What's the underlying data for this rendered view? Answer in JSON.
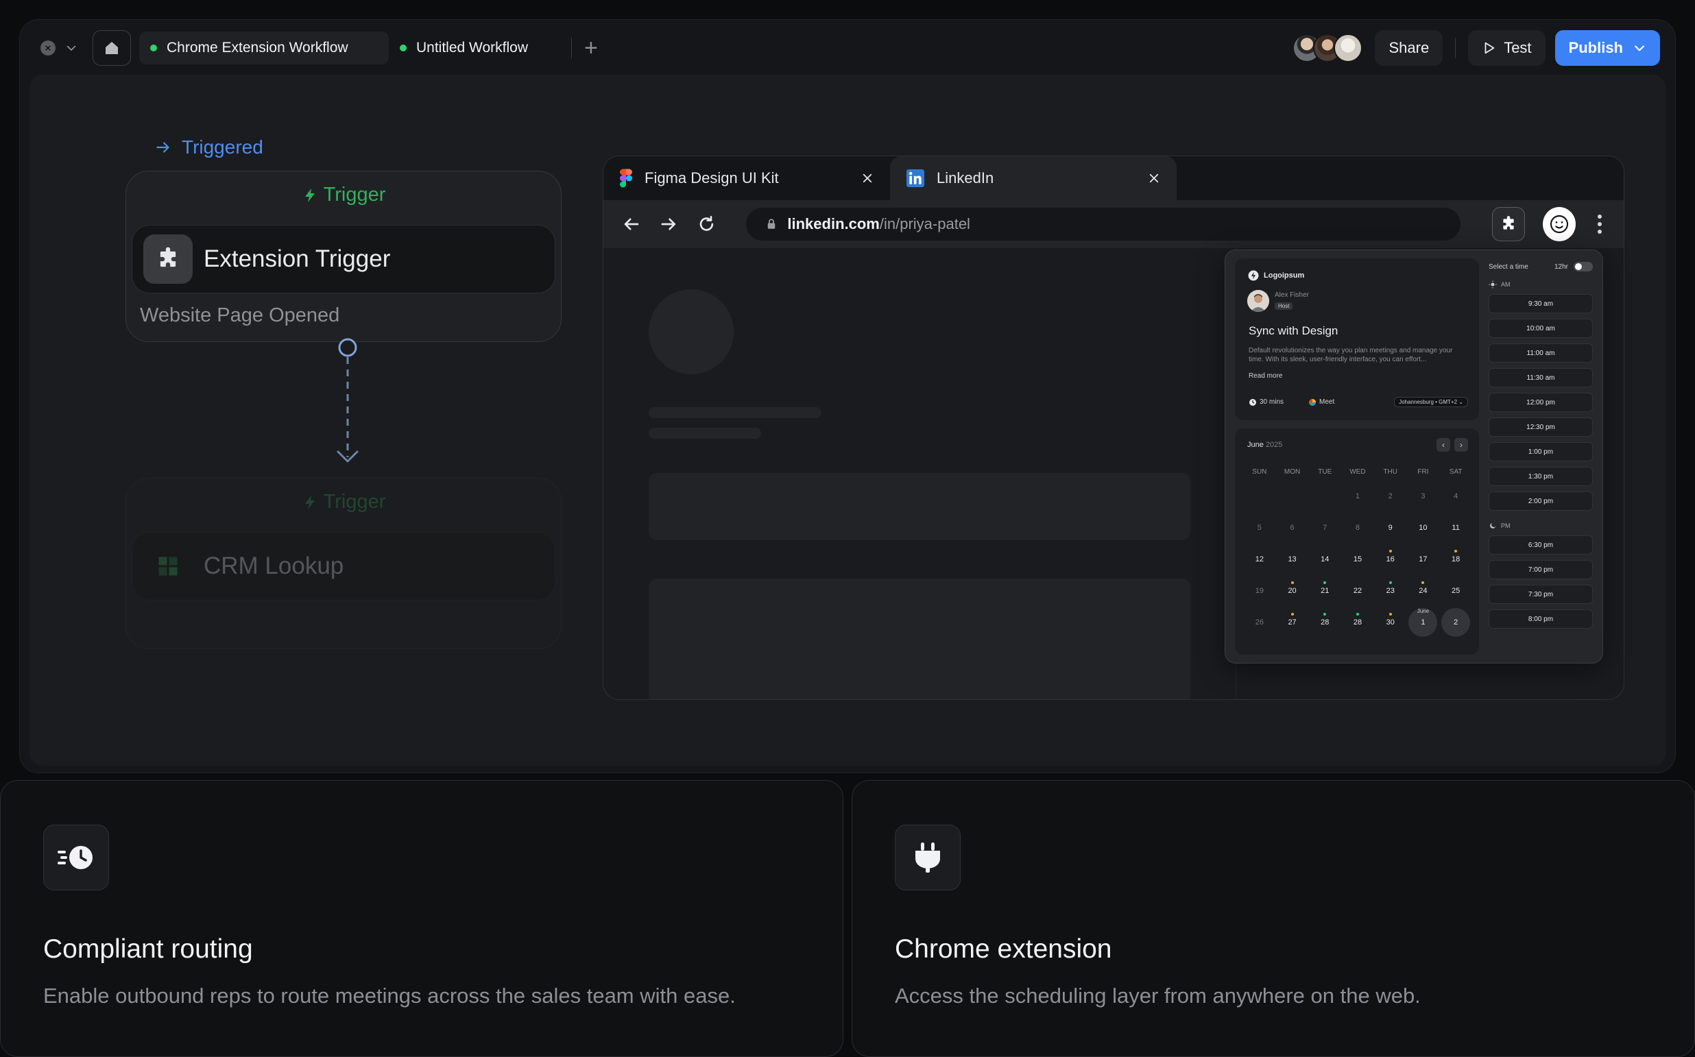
{
  "workflow_tabs": [
    {
      "label": "Chrome Extension Workflow"
    },
    {
      "label": "Untitled Workflow"
    }
  ],
  "toolbar": {
    "share_label": "Share",
    "test_label": "Test",
    "publish_label": "Publish"
  },
  "triggered_label": "Triggered",
  "node1": {
    "header": "Trigger",
    "title": "Extension Trigger",
    "subtitle": "Website Page Opened"
  },
  "node2": {
    "header": "Trigger",
    "title": "CRM Lookup"
  },
  "browser": {
    "tabs": [
      {
        "label": "Figma Design UI Kit"
      },
      {
        "label": "LinkedIn"
      }
    ],
    "url_domain": "linkedin.com",
    "url_path": "/in/priya-patel"
  },
  "scheduler": {
    "logo": "Logoipsum",
    "host_name": "Alex Fisher",
    "host_tag": "Host",
    "event_title": "Sync with Design",
    "event_desc": "Default revolutionizes the way you plan meetings and manage your time. With its sleek, user-friendly interface, you can effort...",
    "read_more": "Read more",
    "duration": "30 mins",
    "location": "Meet",
    "timezone": "Johannesburg • GMT+2",
    "month": "June",
    "year": "2025",
    "weekdays": [
      "SUN",
      "MON",
      "TUE",
      "WED",
      "THU",
      "FRI",
      "SAT"
    ],
    "next_month_label": "June",
    "select_time_label": "Select a time",
    "format_label": "12hr",
    "am_label": "AM",
    "pm_label": "PM",
    "am_slots": [
      "9:30 am",
      "10:00 am",
      "11:00 am",
      "11:30 am",
      "12:00 pm",
      "12:30 pm",
      "1:00 pm",
      "1:30 pm",
      "2:00 pm"
    ],
    "pm_slots": [
      "6:30 pm",
      "7:00 pm",
      "7:30 pm",
      "8:00 pm"
    ]
  },
  "cards": [
    {
      "title": "Compliant routing",
      "desc": "Enable outbound reps to route meetings across the sales team with ease."
    },
    {
      "title": "Chrome extension",
      "desc": "Access the scheduling layer from anywhere on the web."
    }
  ],
  "colors": {
    "accent": "#3c82f6",
    "trigger_green": "#2fb25b",
    "status_green": "#2fd46c"
  }
}
